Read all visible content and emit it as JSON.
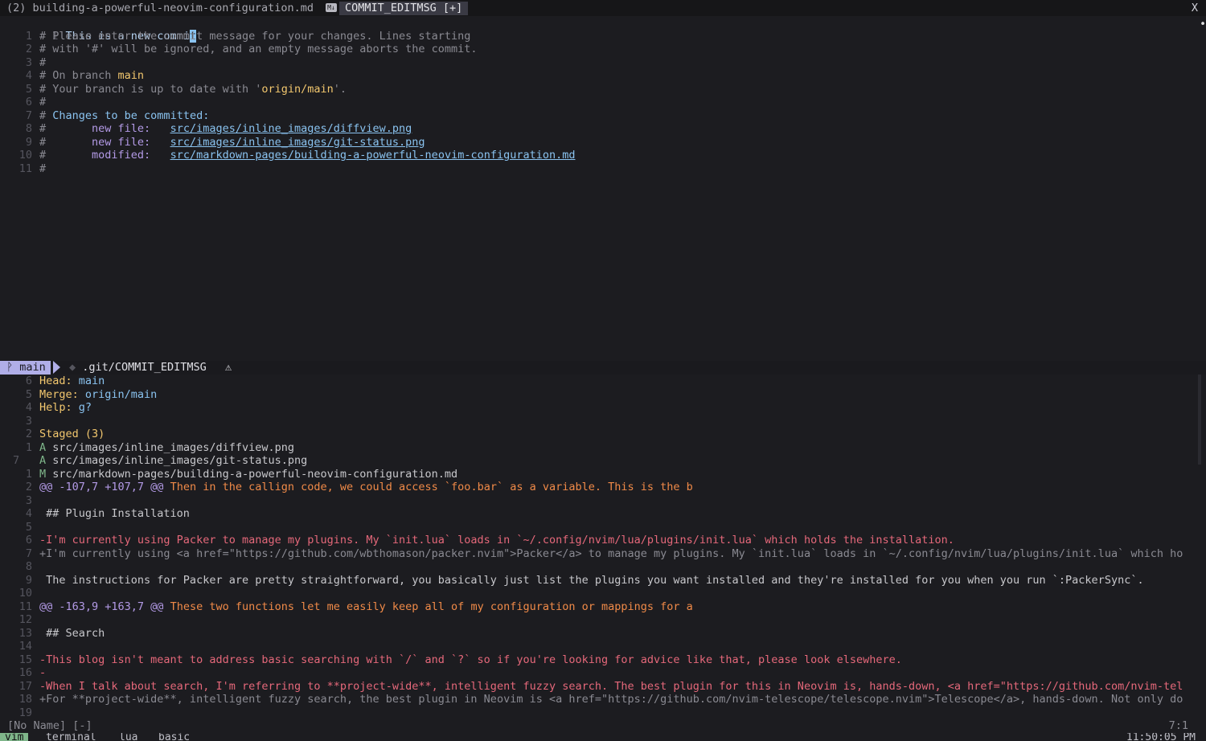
{
  "tabline": {
    "inactive_tab": "(2) building-a-powerful-neovim-configuration.md",
    "icon": "markdown-icon",
    "active_tab": "COMMIT_EDITMSG [+]",
    "close": "X"
  },
  "commit_editor": {
    "first_line_num": "1",
    "first_line_text": "This is a new commi",
    "cursor_char": "t",
    "lines": [
      {
        "n": "1",
        "text": "# Please enter the commit message for your changes. Lines starting"
      },
      {
        "n": "2",
        "text": "# with '#' will be ignored, and an empty message aborts the commit."
      },
      {
        "n": "3",
        "text": "#"
      },
      {
        "n": "4",
        "pre": "# On branch ",
        "hl": "main"
      },
      {
        "n": "5",
        "pre": "# Your branch is up to date with '",
        "hl": "origin/main",
        "post": "'."
      },
      {
        "n": "6",
        "text": "#"
      },
      {
        "n": "7",
        "pre": "# ",
        "blue": "Changes to be committed:"
      },
      {
        "n": "8",
        "pre": "#       ",
        "label": "new file:",
        "gap": "   ",
        "path": "src/images/inline_images/diffview.png"
      },
      {
        "n": "9",
        "pre": "#       ",
        "label": "new file:",
        "gap": "   ",
        "path": "src/images/inline_images/git-status.png"
      },
      {
        "n": "10",
        "pre": "#       ",
        "label": "modified:",
        "gap": "   ",
        "path": "src/markdown-pages/building-a-powerful-neovim-configuration.md"
      },
      {
        "n": "11",
        "text": "#"
      }
    ]
  },
  "statusline": {
    "branch": "P main",
    "file": ".git/COMMIT_EDITMSG",
    "warning_icon": "⚠"
  },
  "fugitive": {
    "lines": [
      {
        "n": "6",
        "key": "Head: ",
        "val": "main"
      },
      {
        "n": "5",
        "key": "Merge: ",
        "val": "origin/main"
      },
      {
        "n": "4",
        "key": "Help: ",
        "val": "g?"
      },
      {
        "n": "3"
      },
      {
        "n": "2",
        "section": "Staged",
        "count": " (3)"
      },
      {
        "n": "1",
        "status": "A",
        "path": " src/images/inline_images/diffview.png"
      },
      {
        "n": "7",
        "status": "A",
        "path": " src/images/inline_images/git-status.png",
        "current": true
      },
      {
        "n": "1",
        "status": "M",
        "path": " src/markdown-pages/building-a-powerful-neovim-configuration.md"
      },
      {
        "n": "2",
        "hunk": "@@ -107,7 +107,7 @@",
        "hunk_ctx": " Then in the callign code, we could access `foo.bar` as a variable. This is the b"
      },
      {
        "n": "3"
      },
      {
        "n": "4",
        "ctx": " ## Plugin Installation"
      },
      {
        "n": "5"
      },
      {
        "n": "6",
        "del": "-I'm currently using Packer to manage my plugins. My `init.lua` loads in `~/.config/nvim/lua/plugins/init.lua` which holds the installation."
      },
      {
        "n": "7",
        "add": "+I'm currently using <a href=\"https://github.com/wbthomason/packer.nvim\">Packer</a> to manage my plugins. My `init.lua` loads in `~/.config/nvim/lua/plugins/init.lua` which ho"
      },
      {
        "n": "8"
      },
      {
        "n": "9",
        "ctx": " The instructions for Packer are pretty straightforward, you basically just list the plugins you want installed and they're installed for you when you run `:PackerSync`."
      },
      {
        "n": "10"
      },
      {
        "n": "11",
        "hunk": "@@ -163,9 +163,7 @@",
        "hunk_ctx": " These two functions let me easily keep all of my configuration or mappings for a"
      },
      {
        "n": "12"
      },
      {
        "n": "13",
        "ctx": " ## Search"
      },
      {
        "n": "14"
      },
      {
        "n": "15",
        "del": "-This blog isn't meant to address basic searching with `/` and `?` so if you're looking for advice like that, please look elsewhere."
      },
      {
        "n": "16",
        "del": "-"
      },
      {
        "n": "17",
        "del": "-When I talk about search, I'm referring to **project-wide**, intelligent fuzzy search. The best plugin for this in Neovim is, hands-down, <a href=\"https://github.com/nvim-tel"
      },
      {
        "n": "18",
        "add": "+For **project-wide**, intelligent fuzzy search, the best plugin in Neovim is <a href=\"https://github.com/nvim-telescope/telescope.nvim\">Telescope</a>, hands-down. Not only do"
      },
      {
        "n": "19"
      }
    ]
  },
  "bottom": {
    "buffer": "[No Name] [-]",
    "position": "7:1"
  },
  "tmux": {
    "windows": [
      "vim",
      "terminal",
      "lua",
      "basic"
    ],
    "clock": "11:50:05 PM"
  }
}
